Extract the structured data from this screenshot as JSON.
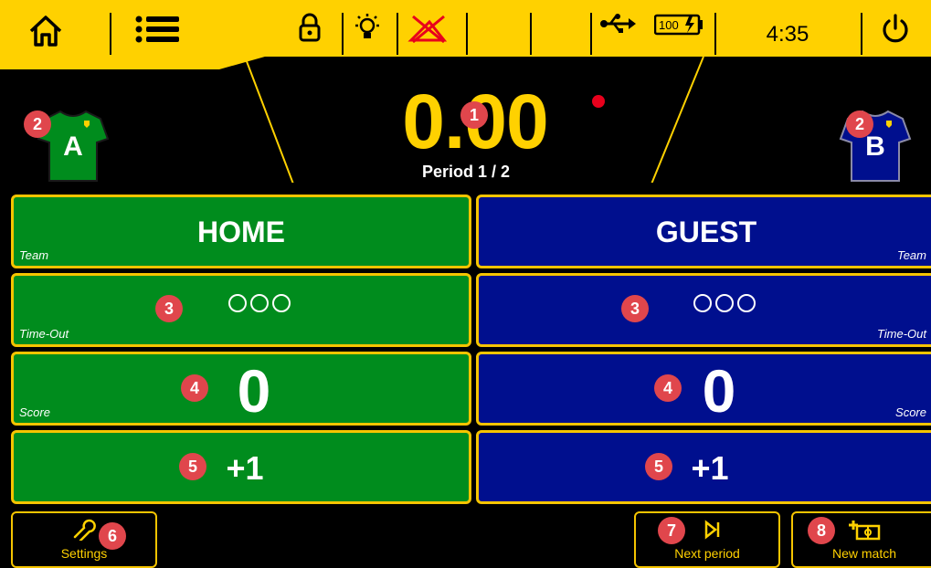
{
  "topbar": {
    "clock": "4:35",
    "battery_label": "100",
    "icons": [
      "home-icon",
      "menu-icon",
      "lock-icon",
      "light-icon",
      "sound-off-icon",
      "usb-icon",
      "battery-icon",
      "power-icon"
    ]
  },
  "timer": {
    "value": "0.00",
    "period": "Period 1 / 2"
  },
  "home": {
    "jersey_letter": "A",
    "team_name": "HOME",
    "team_label": "Team",
    "timeout_label": "Time-Out",
    "score": "0",
    "score_label": "Score",
    "plus_one": "+1",
    "color": "#008c1d"
  },
  "guest": {
    "jersey_letter": "B",
    "team_name": "GUEST",
    "team_label": "Team",
    "timeout_label": "Time-Out",
    "score": "0",
    "score_label": "Score",
    "plus_one": "+1",
    "color": "#000f8e"
  },
  "buttons": {
    "settings": "Settings",
    "next_period": "Next period",
    "new_match": "New match"
  },
  "markers": {
    "m1": "1",
    "m2": "2",
    "m3": "3",
    "m4": "4",
    "m5": "5",
    "m6": "6",
    "m7": "7",
    "m8": "8"
  },
  "colors": {
    "accent": "#ffd100",
    "marker": "#e0464c"
  }
}
